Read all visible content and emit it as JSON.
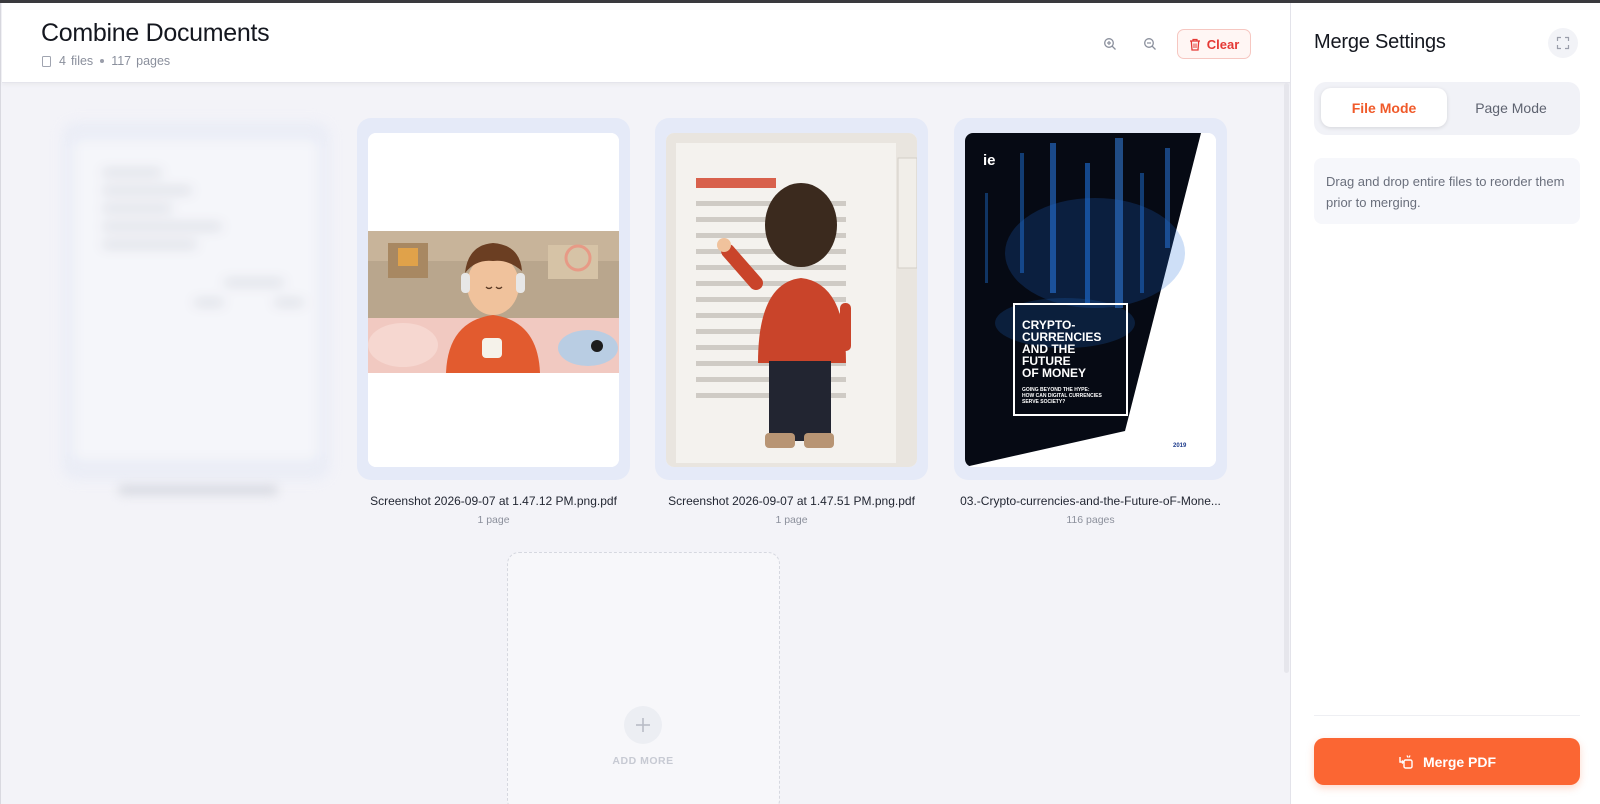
{
  "header": {
    "title": "Combine Documents",
    "files_count": "4",
    "files_label": "files",
    "pages_count": "117",
    "pages_label": "pages",
    "clear_label": "Clear"
  },
  "files": [
    {
      "name": "Screenshot 2026-09-07 at 1.47.12 PM.png.pdf",
      "pages": "1 page"
    },
    {
      "name": "Screenshot 2026-09-07 at 1.47.51 PM.png.pdf",
      "pages": "1 page"
    },
    {
      "name": "03.-Crypto-currencies-and-the-Future-oF-Mone...",
      "pages": "116 pages"
    }
  ],
  "cover": {
    "logo": "ie",
    "title_lines": [
      "CRYPTO-",
      "CURRENCIES",
      "AND THE",
      "FUTURE",
      "OF MONEY"
    ],
    "subtitle_lines": [
      "GOING BEYOND THE HYPE:",
      "HOW CAN DIGITAL CURRENCIES",
      "SERVE SOCIETY?"
    ],
    "year": "2019"
  },
  "add_more": {
    "label": "ADD MORE"
  },
  "sidebar": {
    "title": "Merge Settings",
    "modes": [
      "File Mode",
      "Page Mode"
    ],
    "active_mode": "File Mode",
    "hint": "Drag and drop entire files to reorder them prior to merging.",
    "merge_label": "Merge PDF"
  },
  "colors": {
    "accent": "#fb6633",
    "danger": "#e53935",
    "card_bg": "#e5eaf8"
  },
  "icons": [
    "document-icon",
    "zoom-in-icon",
    "zoom-out-icon",
    "trash-icon",
    "expand-icon",
    "plus-icon",
    "merge-icon"
  ]
}
